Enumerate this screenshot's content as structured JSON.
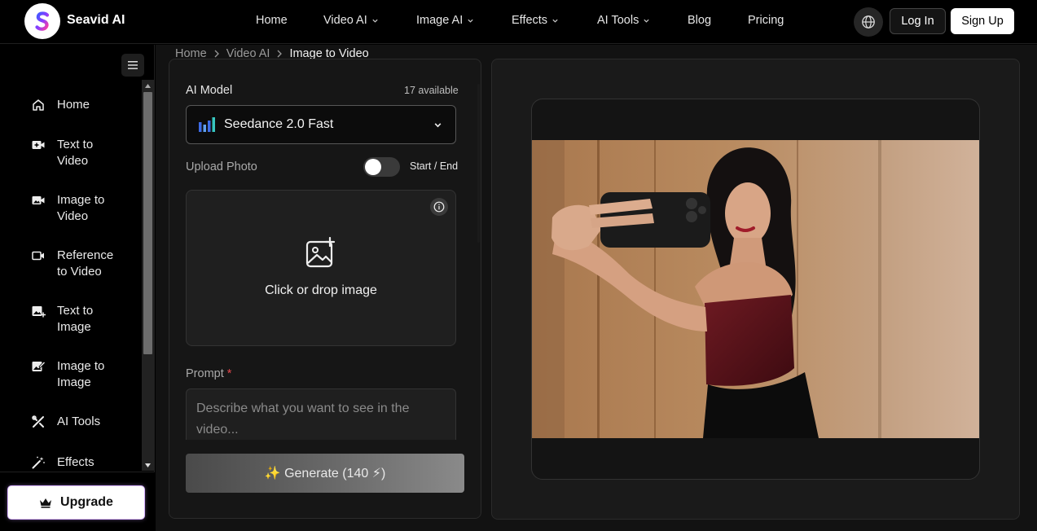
{
  "brand": {
    "name": "Seavid AI",
    "logo_letter": "S"
  },
  "nav": {
    "items": [
      {
        "label": "Home",
        "dropdown": false
      },
      {
        "label": "Video AI",
        "dropdown": true
      },
      {
        "label": "Image AI",
        "dropdown": true
      },
      {
        "label": "Effects",
        "dropdown": true
      },
      {
        "label": "AI Tools",
        "dropdown": true
      },
      {
        "label": "Blog",
        "dropdown": false
      },
      {
        "label": "Pricing",
        "dropdown": false
      }
    ],
    "login_label": "Log In",
    "signup_label": "Sign Up"
  },
  "sidebar": {
    "items": [
      {
        "label": "Home",
        "icon": "home-icon"
      },
      {
        "label": "Text to Video",
        "icon": "video-plus-icon"
      },
      {
        "label": "Image to Video",
        "icon": "image-video-icon"
      },
      {
        "label": "Reference to Video",
        "icon": "video-camera-icon"
      },
      {
        "label": "Text to Image",
        "icon": "image-plus-icon"
      },
      {
        "label": "Image to Image",
        "icon": "image-edit-icon"
      },
      {
        "label": "AI Tools",
        "icon": "tools-icon"
      },
      {
        "label": "Effects",
        "icon": "magic-wand-icon"
      }
    ],
    "upgrade_label": "Upgrade"
  },
  "breadcrumb": {
    "items": [
      "Home",
      "Video AI"
    ],
    "current": "Image to Video"
  },
  "form": {
    "model_label": "AI Model",
    "available": "17 available",
    "model_value": "Seedance 2.0 Fast",
    "upload_label": "Upload Photo",
    "toggle_label": "Start / End",
    "toggle_on": false,
    "drop_text": "Click or drop image",
    "prompt_label": "Prompt",
    "prompt_required": "*",
    "prompt_placeholder": "Describe what you want to see in the video...",
    "generate_label": "✨ Generate (140 ⚡)"
  },
  "colors": {
    "accent": "#ffffff",
    "background": "#121212",
    "panel": "#161616",
    "required": "#e5484d"
  }
}
